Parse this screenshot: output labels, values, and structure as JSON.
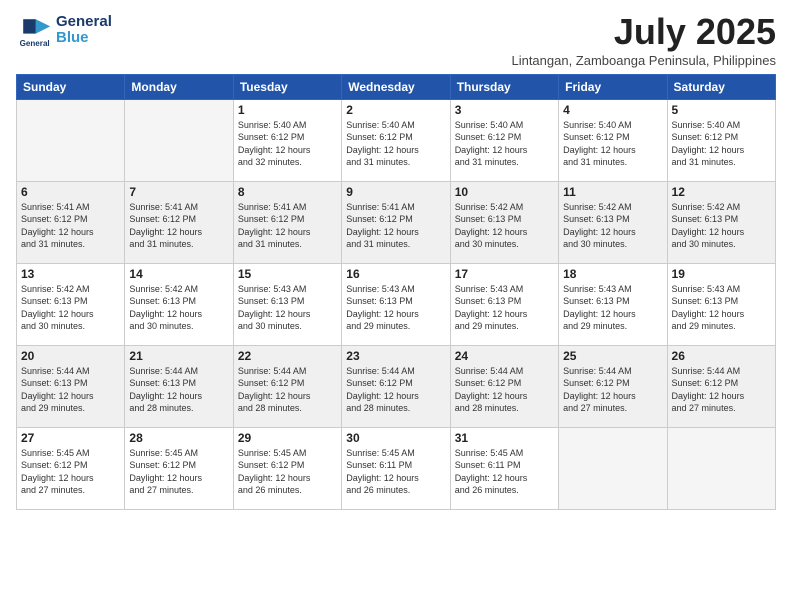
{
  "header": {
    "logo_line1": "General",
    "logo_line2": "Blue",
    "month_title": "July 2025",
    "location": "Lintangan, Zamboanga Peninsula, Philippines"
  },
  "days_of_week": [
    "Sunday",
    "Monday",
    "Tuesday",
    "Wednesday",
    "Thursday",
    "Friday",
    "Saturday"
  ],
  "weeks": [
    [
      {
        "num": "",
        "info": ""
      },
      {
        "num": "",
        "info": ""
      },
      {
        "num": "1",
        "info": "Sunrise: 5:40 AM\nSunset: 6:12 PM\nDaylight: 12 hours\nand 32 minutes."
      },
      {
        "num": "2",
        "info": "Sunrise: 5:40 AM\nSunset: 6:12 PM\nDaylight: 12 hours\nand 31 minutes."
      },
      {
        "num": "3",
        "info": "Sunrise: 5:40 AM\nSunset: 6:12 PM\nDaylight: 12 hours\nand 31 minutes."
      },
      {
        "num": "4",
        "info": "Sunrise: 5:40 AM\nSunset: 6:12 PM\nDaylight: 12 hours\nand 31 minutes."
      },
      {
        "num": "5",
        "info": "Sunrise: 5:40 AM\nSunset: 6:12 PM\nDaylight: 12 hours\nand 31 minutes."
      }
    ],
    [
      {
        "num": "6",
        "info": "Sunrise: 5:41 AM\nSunset: 6:12 PM\nDaylight: 12 hours\nand 31 minutes."
      },
      {
        "num": "7",
        "info": "Sunrise: 5:41 AM\nSunset: 6:12 PM\nDaylight: 12 hours\nand 31 minutes."
      },
      {
        "num": "8",
        "info": "Sunrise: 5:41 AM\nSunset: 6:12 PM\nDaylight: 12 hours\nand 31 minutes."
      },
      {
        "num": "9",
        "info": "Sunrise: 5:41 AM\nSunset: 6:12 PM\nDaylight: 12 hours\nand 31 minutes."
      },
      {
        "num": "10",
        "info": "Sunrise: 5:42 AM\nSunset: 6:13 PM\nDaylight: 12 hours\nand 30 minutes."
      },
      {
        "num": "11",
        "info": "Sunrise: 5:42 AM\nSunset: 6:13 PM\nDaylight: 12 hours\nand 30 minutes."
      },
      {
        "num": "12",
        "info": "Sunrise: 5:42 AM\nSunset: 6:13 PM\nDaylight: 12 hours\nand 30 minutes."
      }
    ],
    [
      {
        "num": "13",
        "info": "Sunrise: 5:42 AM\nSunset: 6:13 PM\nDaylight: 12 hours\nand 30 minutes."
      },
      {
        "num": "14",
        "info": "Sunrise: 5:42 AM\nSunset: 6:13 PM\nDaylight: 12 hours\nand 30 minutes."
      },
      {
        "num": "15",
        "info": "Sunrise: 5:43 AM\nSunset: 6:13 PM\nDaylight: 12 hours\nand 30 minutes."
      },
      {
        "num": "16",
        "info": "Sunrise: 5:43 AM\nSunset: 6:13 PM\nDaylight: 12 hours\nand 29 minutes."
      },
      {
        "num": "17",
        "info": "Sunrise: 5:43 AM\nSunset: 6:13 PM\nDaylight: 12 hours\nand 29 minutes."
      },
      {
        "num": "18",
        "info": "Sunrise: 5:43 AM\nSunset: 6:13 PM\nDaylight: 12 hours\nand 29 minutes."
      },
      {
        "num": "19",
        "info": "Sunrise: 5:43 AM\nSunset: 6:13 PM\nDaylight: 12 hours\nand 29 minutes."
      }
    ],
    [
      {
        "num": "20",
        "info": "Sunrise: 5:44 AM\nSunset: 6:13 PM\nDaylight: 12 hours\nand 29 minutes."
      },
      {
        "num": "21",
        "info": "Sunrise: 5:44 AM\nSunset: 6:13 PM\nDaylight: 12 hours\nand 28 minutes."
      },
      {
        "num": "22",
        "info": "Sunrise: 5:44 AM\nSunset: 6:12 PM\nDaylight: 12 hours\nand 28 minutes."
      },
      {
        "num": "23",
        "info": "Sunrise: 5:44 AM\nSunset: 6:12 PM\nDaylight: 12 hours\nand 28 minutes."
      },
      {
        "num": "24",
        "info": "Sunrise: 5:44 AM\nSunset: 6:12 PM\nDaylight: 12 hours\nand 28 minutes."
      },
      {
        "num": "25",
        "info": "Sunrise: 5:44 AM\nSunset: 6:12 PM\nDaylight: 12 hours\nand 27 minutes."
      },
      {
        "num": "26",
        "info": "Sunrise: 5:44 AM\nSunset: 6:12 PM\nDaylight: 12 hours\nand 27 minutes."
      }
    ],
    [
      {
        "num": "27",
        "info": "Sunrise: 5:45 AM\nSunset: 6:12 PM\nDaylight: 12 hours\nand 27 minutes."
      },
      {
        "num": "28",
        "info": "Sunrise: 5:45 AM\nSunset: 6:12 PM\nDaylight: 12 hours\nand 27 minutes."
      },
      {
        "num": "29",
        "info": "Sunrise: 5:45 AM\nSunset: 6:12 PM\nDaylight: 12 hours\nand 26 minutes."
      },
      {
        "num": "30",
        "info": "Sunrise: 5:45 AM\nSunset: 6:11 PM\nDaylight: 12 hours\nand 26 minutes."
      },
      {
        "num": "31",
        "info": "Sunrise: 5:45 AM\nSunset: 6:11 PM\nDaylight: 12 hours\nand 26 minutes."
      },
      {
        "num": "",
        "info": ""
      },
      {
        "num": "",
        "info": ""
      }
    ]
  ]
}
